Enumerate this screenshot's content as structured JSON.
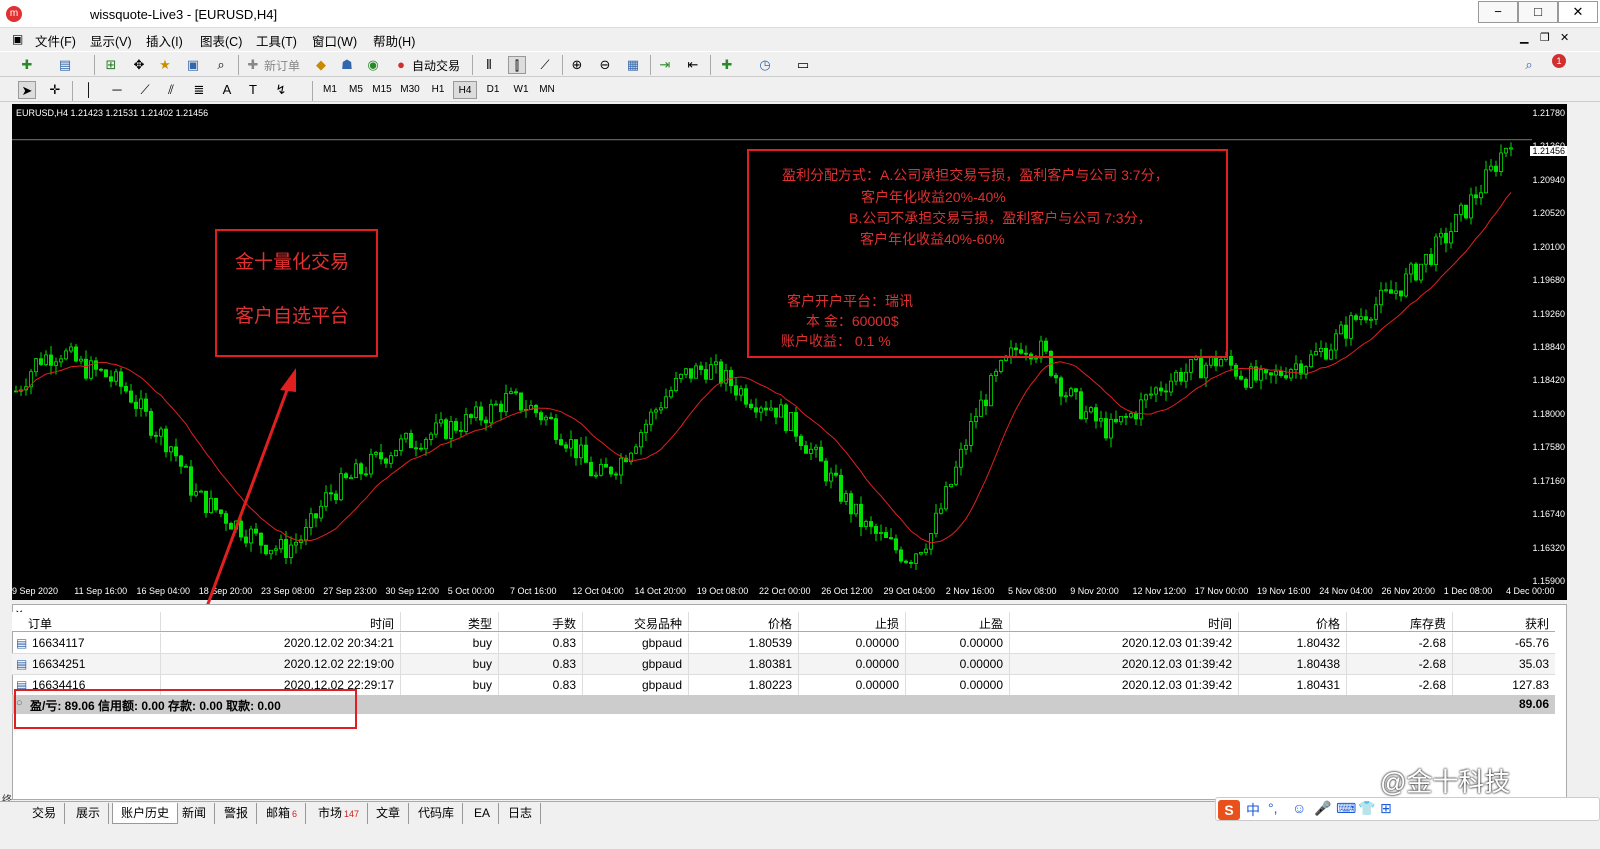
{
  "window": {
    "title": "wissquote-Live3 - [EURUSD,H4]",
    "min": "−",
    "max": "□",
    "close": "✕"
  },
  "menu": [
    "文件(F)",
    "显示(V)",
    "插入(I)",
    "图表(C)",
    "工具(T)",
    "窗口(W)",
    "帮助(H)"
  ],
  "toolbar": {
    "new_order": "新订单",
    "auto_trade": "自动交易"
  },
  "timeframes": [
    "M1",
    "M5",
    "M15",
    "M30",
    "H1",
    "H4",
    "D1",
    "W1",
    "MN"
  ],
  "active_timeframe": "H4",
  "chart": {
    "symbol_info": "EURUSD,H4  1.21423 1.21531 1.21402 1.21456",
    "current_price": "1.21456",
    "price_ticks": [
      "1.21780",
      "1.21360",
      "1.20940",
      "1.20520",
      "1.20100",
      "1.19680",
      "1.19260",
      "1.18840",
      "1.18420",
      "1.18000",
      "1.17580",
      "1.17160",
      "1.16740",
      "1.16320",
      "1.15900"
    ],
    "time_ticks": [
      "9 Sep 2020",
      "11 Sep 16:00",
      "16 Sep 04:00",
      "18 Sep 20:00",
      "23 Sep 08:00",
      "27 Sep 23:00",
      "30 Sep 12:00",
      "5 Oct 00:00",
      "7 Oct 16:00",
      "12 Oct 04:00",
      "14 Oct 20:00",
      "19 Oct 08:00",
      "22 Oct 00:00",
      "26 Oct 12:00",
      "29 Oct 04:00",
      "2 Nov 16:00",
      "5 Nov 08:00",
      "9 Nov 20:00",
      "12 Nov 12:00",
      "17 Nov 00:00",
      "19 Nov 16:00",
      "24 Nov 04:00",
      "26 Nov 20:00",
      "1 Dec 08:00",
      "4 Dec 00:00"
    ],
    "colors": {
      "candle": "#00e000",
      "ma": "#e02020",
      "bg": "#000000",
      "annotation": "#e03030"
    }
  },
  "chart_data": {
    "type": "line",
    "series": [
      {
        "values": [
          1.183,
          1.187,
          1.188,
          1.186,
          1.185,
          1.183,
          1.179,
          1.176,
          1.17,
          1.168,
          1.166,
          1.164,
          1.163,
          1.165,
          1.17,
          1.172,
          1.174,
          1.176,
          1.177,
          1.178,
          1.179,
          1.18,
          1.182,
          1.181,
          1.179,
          1.176,
          1.172,
          1.174,
          1.178,
          1.182,
          1.185,
          1.186,
          1.184,
          1.182,
          1.181,
          1.178,
          1.174,
          1.17,
          1.166,
          1.164,
          1.162,
          1.165,
          1.172,
          1.18,
          1.185,
          1.189,
          1.188,
          1.183,
          1.18,
          1.178,
          1.18,
          1.183,
          1.185,
          1.186,
          1.187,
          1.185,
          1.184,
          1.186,
          1.187,
          1.189,
          1.192,
          1.194,
          1.196,
          1.199,
          1.202,
          1.206,
          1.21,
          1.215
        ]
      }
    ],
    "ylim": [
      1.159,
      1.2178
    ]
  },
  "annotations": {
    "left_line1": "金十量化交易",
    "left_line2": "客户自选平台",
    "right_line1": "盈利分配方式：A.公司承担交易亏损，盈利客户与公司 3:7分，",
    "right_line2": "客户年化收益20%-40%",
    "right_line3": "B.公司不承担交易亏损，盈利客户与公司 7:3分，",
    "right_line4": "客户年化收益40%-60%",
    "right_line5": "客户开户平台：瑞讯",
    "right_line6": "本    金：60000$",
    "right_line7": "账户收益：  0.1  %"
  },
  "terminal": {
    "headers": [
      "订单",
      "时间",
      "类型",
      "手数",
      "交易品种",
      "价格",
      "止损",
      "止盈",
      "时间",
      "价格",
      "库存费",
      "获利"
    ],
    "rows": [
      [
        "16634117",
        "2020.12.02 20:34:21",
        "buy",
        "0.83",
        "gbpaud",
        "1.80539",
        "0.00000",
        "0.00000",
        "2020.12.03 01:39:42",
        "1.80432",
        "-2.68",
        "-65.76"
      ],
      [
        "16634251",
        "2020.12.02 22:19:00",
        "buy",
        "0.83",
        "gbpaud",
        "1.80381",
        "0.00000",
        "0.00000",
        "2020.12.03 01:39:42",
        "1.80438",
        "-2.68",
        "35.03"
      ],
      [
        "16634416",
        "2020.12.02 22:29:17",
        "buy",
        "0.83",
        "gbpaud",
        "1.80223",
        "0.00000",
        "0.00000",
        "2020.12.03 01:39:42",
        "1.80431",
        "-2.68",
        "127.83"
      ]
    ],
    "summary": "盈/亏: 89.06  信用额: 0.00  存款: 0.00  取款: 0.00",
    "total": "89.06"
  },
  "tabs": [
    {
      "label": "交易"
    },
    {
      "label": "展示"
    },
    {
      "label": "账户历史"
    },
    {
      "label": "新闻"
    },
    {
      "label": "警报"
    },
    {
      "label": "邮箱",
      "count": "6"
    },
    {
      "label": "市场",
      "count": "147"
    },
    {
      "label": "文章"
    },
    {
      "label": "代码库"
    },
    {
      "label": "EA"
    },
    {
      "label": "日志"
    }
  ],
  "active_tab": "账户历史",
  "side_label": "终端",
  "watermark": "@金十科技",
  "ime": {
    "logo": "S",
    "mode": "中"
  }
}
